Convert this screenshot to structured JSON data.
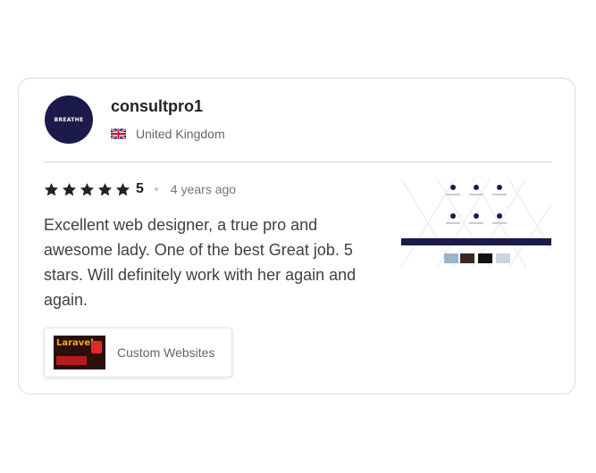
{
  "reviewer": {
    "username": "consultpro1",
    "avatar_text": "BREATHE",
    "country": "United Kingdom",
    "flag_icon": "uk-flag-icon"
  },
  "review": {
    "rating": "5",
    "stars": 5,
    "time_ago": "4 years ago",
    "text": "Excellent web designer, a true pro and awesome lady. One of the best Great job. 5 stars. Will definitely work with her again and again."
  },
  "gig": {
    "label": "Custom Websites",
    "thumb_text": "Laravel"
  },
  "colors": {
    "star": "#222325",
    "avatar_bg": "#1a1b4b",
    "text": "#404145",
    "muted": "#62646a"
  }
}
